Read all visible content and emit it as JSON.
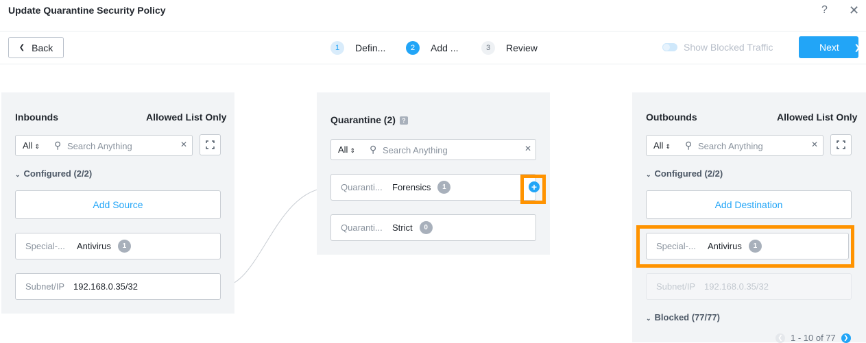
{
  "header": {
    "title": "Update Quarantine Security Policy",
    "help_icon": "?",
    "close_icon": "✕"
  },
  "toolbar": {
    "back_label": "Back",
    "steps": [
      {
        "num": "1",
        "label": "Defin..."
      },
      {
        "num": "2",
        "label": "Add ..."
      },
      {
        "num": "3",
        "label": "Review"
      }
    ],
    "show_blocked_label": "Show Blocked Traffic",
    "next_label": "Next"
  },
  "inbounds": {
    "title": "Inbounds",
    "subtitle": "Allowed List Only",
    "filter": "All",
    "search_placeholder": "Search Anything",
    "configured_label": "Configured (2/2)",
    "add_label": "Add Source",
    "items": [
      {
        "key": "Special-...",
        "value": "Antivirus",
        "badge": "1"
      },
      {
        "key": "Subnet/IP",
        "value": "192.168.0.35/32"
      }
    ]
  },
  "quarantine": {
    "title": "Quarantine (2)",
    "filter": "All",
    "search_placeholder": "Search Anything",
    "items": [
      {
        "key": "Quaranti...",
        "value": "Forensics",
        "badge": "1"
      },
      {
        "key": "Quaranti...",
        "value": "Strict",
        "badge": "0"
      }
    ]
  },
  "outbounds": {
    "title": "Outbounds",
    "subtitle": "Allowed List Only",
    "filter": "All",
    "search_placeholder": "Search Anything",
    "configured_label": "Configured (2/2)",
    "add_label": "Add Destination",
    "items": [
      {
        "key": "Special-...",
        "value": "Antivirus",
        "badge": "1"
      },
      {
        "key": "Subnet/IP",
        "value": "192.168.0.35/32"
      }
    ],
    "blocked_label": "Blocked (77/77)",
    "pager_label": "1 - 10 of 77"
  },
  "colors": {
    "accent": "#22a5f7",
    "highlight": "#ff9300",
    "panel_bg": "#f2f4f6"
  }
}
